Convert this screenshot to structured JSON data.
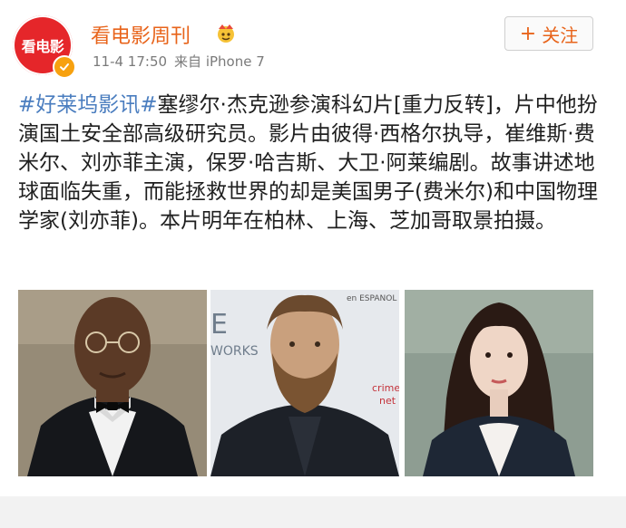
{
  "post": {
    "account_name": "看电影周刊",
    "avatar_text": "看电影",
    "timestamp": "11-4 17:50",
    "source": "来自 iPhone 7",
    "follow_label": "关注",
    "hashtag": "#好莱坞影讯#",
    "body": "塞缪尔·杰克逊参演科幻片[重力反转]，片中他扮演国土安全部高级研究员。影片由彼得·西格尔执导，崔维斯·费米尔、刘亦菲主演，保罗·哈吉斯、大卫·阿莱编剧。故事讲述地球面临失重，而能拯救世界的却是美国男子(费米尔)和中国物理学家(刘亦菲)。本片明年在柏林、上海、芝加哥取景拍摄。"
  },
  "photos": [
    {
      "icon": "person-photo"
    },
    {
      "icon": "person-photo",
      "backdrop_texts": [
        "E",
        "WORKS",
        "en ESPANOL",
        "crime",
        "net"
      ]
    },
    {
      "icon": "person-photo"
    }
  ],
  "colors": {
    "accent": "#e8641b",
    "hashtag": "#4a7dbf",
    "avatar_bg": "#e5262a",
    "verified": "#f7a10f"
  }
}
